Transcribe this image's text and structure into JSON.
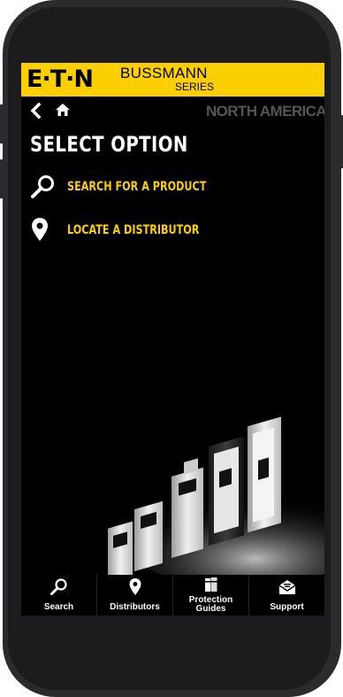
{
  "brand": {
    "logo_text": "E·T·N",
    "brand_name": "BUSSMANN",
    "brand_sub": "SERIES"
  },
  "nav": {
    "region": "NORTH AMERICA"
  },
  "main": {
    "title": "SELECT OPTION",
    "options": [
      {
        "label": "SEARCH FOR A PRODUCT",
        "icon": "magnifier-icon"
      },
      {
        "label": "LOCATE A DISTRIBUTOR",
        "icon": "map-pin-icon"
      }
    ]
  },
  "tabbar": {
    "items": [
      {
        "label": "Search",
        "icon": "magnifier-icon"
      },
      {
        "label": "Distributors",
        "icon": "map-pin-icon"
      },
      {
        "label_line1": "Protection",
        "label_line2": "Guides",
        "icon": "books-icon"
      },
      {
        "label": "Support",
        "icon": "envelope-icon"
      }
    ]
  },
  "colors": {
    "accent": "#fcd000",
    "background": "#000000",
    "region_text": "#555555"
  }
}
